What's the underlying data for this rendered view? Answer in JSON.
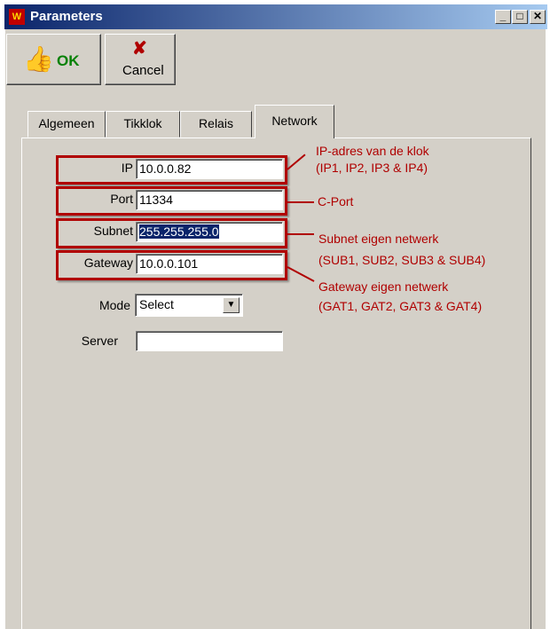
{
  "window": {
    "title": "Parameters",
    "app_icon": "app-icon"
  },
  "title_buttons": {
    "minimize": "_",
    "maximize": "□",
    "close": "✕"
  },
  "toolbar": {
    "ok_label": "OK",
    "ok_icon": "thumbs-up-icon",
    "cancel_label": "Cancel",
    "cancel_icon": "red-x-icon"
  },
  "tabs": [
    {
      "label": "Algemeen"
    },
    {
      "label": "Tikklok"
    },
    {
      "label": "Relais"
    },
    {
      "label": "Network",
      "active": true
    }
  ],
  "network": {
    "ip_label": "IP",
    "ip_value": "10.0.0.82",
    "port_label": "Port",
    "port_value": "11334",
    "subnet_label": "Subnet",
    "subnet_value": "255.255.255.0",
    "gateway_label": "Gateway",
    "gateway_value": "10.0.0.101",
    "mode_label": "Mode",
    "mode_value": "Select",
    "server_label": "Server",
    "server_value": ""
  },
  "annotations": {
    "ip_line1": "IP-adres van de klok",
    "ip_line2": "(IP1, IP2, IP3 & IP4)",
    "port": "C-Port",
    "subnet_line1": "Subnet eigen netwerk",
    "subnet_line2": "(SUB1, SUB2, SUB3 & SUB4)",
    "gateway_line1": "Gateway eigen netwerk",
    "gateway_line2": "(GAT1, GAT2, GAT3 & GAT4)"
  },
  "colors": {
    "annotation_red": "#b00000",
    "window_face": "#d4d0c8",
    "titlebar": "#0a246a",
    "ok_green": "#008000"
  }
}
